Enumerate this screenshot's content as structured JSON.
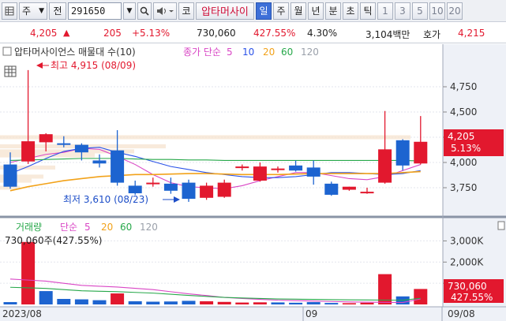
{
  "toolbar": {
    "market_icon": "grid-icon",
    "market_label": "주",
    "type_label": "전",
    "code": "291650",
    "dropdown_icon": "chevron-down-icon",
    "search_icon": "search-icon",
    "sound_icon": "speaker-icon",
    "market_btn": "코",
    "stock_name": "압타머사이",
    "periods": [
      "일",
      "주",
      "월",
      "년",
      "분",
      "초",
      "틱"
    ],
    "selected_period": "일",
    "minutes": [
      "1",
      "3",
      "5",
      "10",
      "20"
    ]
  },
  "quote": {
    "price": "4,205",
    "direction_icon": "up-triangle-icon",
    "change": "205",
    "change_pct": "+5.13%",
    "volume": "730,060",
    "volume_ratio": "427.55%",
    "turnover": "4.30%",
    "amount": "3,104백만",
    "bid_label": "호가",
    "bid_price": "4,215"
  },
  "chart": {
    "title": "압타머사이언스 매물대 수(10)",
    "ma_label": "종가 단순",
    "ma_periods": [
      "5",
      "10",
      "20",
      "60",
      "120"
    ],
    "ma_colors": [
      "#d946c5",
      "#2a52e8",
      "#f2a21a",
      "#27a84a",
      "#9aa0aa"
    ],
    "high_label": "최고 4,915 (08/09)",
    "low_label": "최저 3,610 (08/23)",
    "price_ticks": [
      "4,750",
      "4,500",
      "4,250",
      "4,000",
      "3,750"
    ],
    "current_price_tag": "4,205",
    "current_pct_tag": "5.13%",
    "up_color": "#e2182e",
    "down_color": "#1d64d0"
  },
  "volume_panel": {
    "title": "거래량",
    "ma_label": "단순",
    "ma_periods": [
      "5",
      "20",
      "60",
      "120"
    ],
    "ma_colors": [
      "#d946c5",
      "#f2a21a",
      "#27a84a",
      "#9aa0aa"
    ],
    "value_label": "730,060주(427.55%)",
    "axis_ticks": [
      "3,000K",
      "2,000K",
      "1,000K"
    ],
    "current_tag": "730,060",
    "current_pct_tag": "427.55%"
  },
  "date_axis": {
    "labels": [
      "2023/08",
      "09",
      "09/08"
    ]
  },
  "chart_data": {
    "type": "candlestick",
    "price_ylim": [
      3500,
      5000
    ],
    "volume_ylim": [
      0,
      3500
    ],
    "candles": [
      {
        "o": 3980,
        "h": 4100,
        "l": 3740,
        "c": 3760
      },
      {
        "o": 4010,
        "h": 4915,
        "l": 3985,
        "c": 4210
      },
      {
        "o": 4200,
        "h": 4290,
        "l": 4110,
        "c": 4280
      },
      {
        "o": 4190,
        "h": 4260,
        "l": 4150,
        "c": 4175
      },
      {
        "o": 4175,
        "h": 4190,
        "l": 4020,
        "c": 4100
      },
      {
        "o": 4020,
        "h": 4080,
        "l": 3950,
        "c": 3990
      },
      {
        "o": 4120,
        "h": 4320,
        "l": 3770,
        "c": 3800
      },
      {
        "o": 3770,
        "h": 3820,
        "l": 3680,
        "c": 3695
      },
      {
        "o": 3800,
        "h": 3850,
        "l": 3760,
        "c": 3800
      },
      {
        "o": 3790,
        "h": 3850,
        "l": 3690,
        "c": 3720
      },
      {
        "o": 3800,
        "h": 3830,
        "l": 3610,
        "c": 3640
      },
      {
        "o": 3650,
        "h": 3800,
        "l": 3630,
        "c": 3770
      },
      {
        "o": 3660,
        "h": 3830,
        "l": 3650,
        "c": 3800
      },
      {
        "o": 3950,
        "h": 3980,
        "l": 3920,
        "c": 3960
      },
      {
        "o": 3820,
        "h": 4000,
        "l": 3810,
        "c": 3960
      },
      {
        "o": 3940,
        "h": 3960,
        "l": 3900,
        "c": 3940
      },
      {
        "o": 3970,
        "h": 4020,
        "l": 3910,
        "c": 3920
      },
      {
        "o": 3950,
        "h": 4020,
        "l": 3780,
        "c": 3860
      },
      {
        "o": 3790,
        "h": 3810,
        "l": 3670,
        "c": 3680
      },
      {
        "o": 3730,
        "h": 3760,
        "l": 3720,
        "c": 3760
      },
      {
        "o": 3710,
        "h": 3750,
        "l": 3690,
        "c": 3710
      },
      {
        "o": 3800,
        "h": 4510,
        "l": 3790,
        "c": 4130
      },
      {
        "o": 4220,
        "h": 4230,
        "l": 3920,
        "c": 3970
      },
      {
        "o": 3990,
        "h": 4460,
        "l": 3980,
        "c": 4205
      }
    ],
    "volumes": [
      110,
      2950,
      630,
      260,
      240,
      200,
      520,
      150,
      130,
      140,
      170,
      150,
      120,
      90,
      100,
      95,
      80,
      110,
      70,
      60,
      80,
      1430,
      380,
      730
    ],
    "volume_colors": [
      "d",
      "u",
      "d",
      "d",
      "d",
      "d",
      "u",
      "d",
      "d",
      "d",
      "d",
      "u",
      "u",
      "u",
      "u",
      "d",
      "d",
      "d",
      "d",
      "u",
      "u",
      "u",
      "d",
      "u"
    ],
    "ma5": [
      4000,
      4040,
      4080,
      4100,
      4140,
      4130,
      4060,
      3980,
      3880,
      3800,
      3760,
      3750,
      3740,
      3770,
      3820,
      3860,
      3900,
      3900,
      3870,
      3840,
      3830,
      3860,
      3920,
      3980
    ],
    "ma10": [
      3890,
      3960,
      4040,
      4110,
      4140,
      4150,
      4100,
      4060,
      4010,
      3960,
      3930,
      3900,
      3880,
      3860,
      3850,
      3850,
      3860,
      3880,
      3900,
      3900,
      3890,
      3880,
      3890,
      3920
    ],
    "ma20": [
      3720,
      3760,
      3790,
      3820,
      3840,
      3860,
      3870,
      3880,
      3880,
      3885,
      3890,
      3890,
      3885,
      3880,
      3880,
      3880,
      3885,
      3890,
      3890,
      3890,
      3890,
      3890,
      3900,
      3910
    ],
    "ma60": [
      4020,
      4025,
      4030,
      4035,
      4040,
      4040,
      4040,
      4035,
      4030,
      4030,
      4025,
      4025,
      4020,
      4020,
      4020,
      4020,
      4020,
      4020,
      4020,
      4020,
      4020,
      4020,
      4020,
      4015
    ],
    "vol_ma5": [
      1200,
      1150,
      1100,
      1000,
      900,
      860,
      820,
      760,
      700,
      600,
      500,
      420,
      330,
      280,
      240,
      200,
      180,
      160,
      140,
      120,
      110,
      100,
      90,
      260
    ]
  }
}
